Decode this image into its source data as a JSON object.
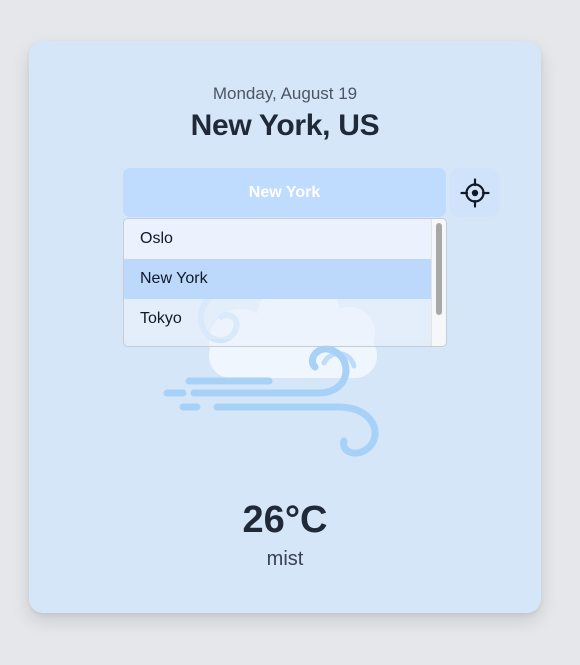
{
  "header": {
    "date": "Monday, August 19",
    "location": "New York, US"
  },
  "city_select": {
    "selected": "New York",
    "options": [
      "Oslo",
      "New York",
      "Tokyo"
    ]
  },
  "weather": {
    "temperature": "26°C",
    "condition": "mist",
    "icon": "wind-cloud-icon"
  },
  "icons": {
    "locate": "crosshair-icon"
  },
  "colors": {
    "card_bg": "#d6e6f9",
    "select_bg": "#bfdbfe",
    "selected_option": "#bcd8fb",
    "text_dark": "#1f2937"
  }
}
